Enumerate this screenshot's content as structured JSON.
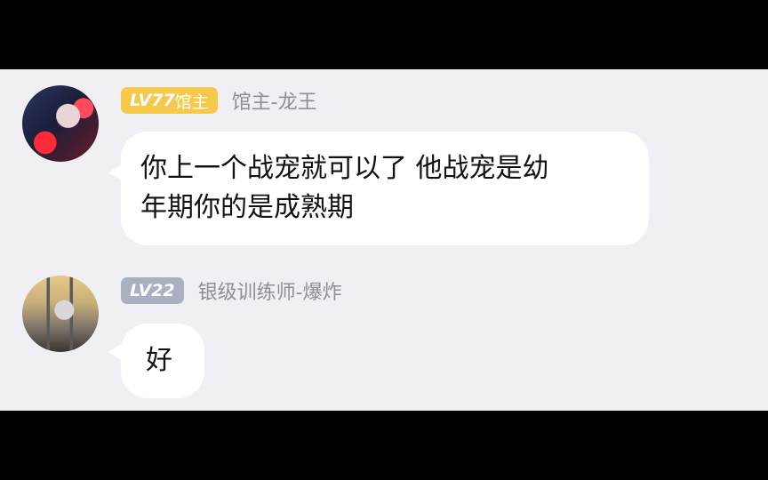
{
  "messages": [
    {
      "level_prefix": "LV",
      "level_number": "77",
      "level_title": "馆主",
      "username": "馆主-龙王",
      "lines": [
        "你上一个战宠就可以了 他战宠是幼",
        "年期你的是成熟期"
      ],
      "badge_color": "#f7c94a",
      "avatar_icon": "anime-character-avatar-icon"
    },
    {
      "level_prefix": "LV",
      "level_number": "22",
      "username": "银级训练师-爆炸",
      "text": "好",
      "badge_color": "#aab0c2",
      "avatar_icon": "anime-character-avatar-icon"
    }
  ],
  "colors": {
    "background": "#efeff4",
    "bubble": "#ffffff",
    "username": "#8e8e96",
    "letterbox": "#000000"
  }
}
